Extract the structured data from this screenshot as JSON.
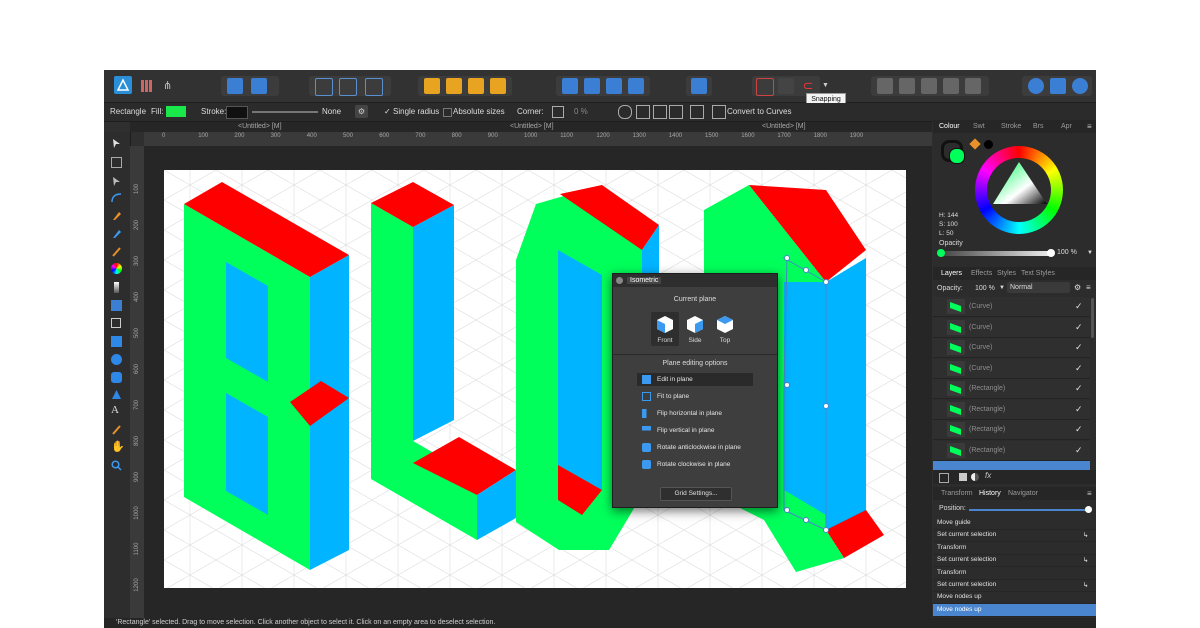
{
  "toolbar": {
    "snapping_tooltip": "Snapping"
  },
  "context": {
    "tool": "Rectangle",
    "fill_label": "Fill:",
    "fill_color": "#1ae84a",
    "stroke_label": "Stroke:",
    "stroke_value": "None",
    "single_radius": "Single radius",
    "absolute_sizes": "Absolute sizes",
    "corner_label": "Corner:",
    "corner_value": "0 %",
    "convert_label": "Convert to Curves"
  },
  "doc_tabs": [
    "<Untitled> [M]",
    "<Untitled> [M]",
    "<Untitled> [M]"
  ],
  "ruler": {
    "h": [
      "0",
      "100",
      "200",
      "300",
      "400",
      "500",
      "600",
      "700",
      "800",
      "900",
      "1000",
      "1100",
      "1200",
      "1300",
      "1400",
      "1500",
      "1600",
      "1700",
      "1800",
      "1900"
    ],
    "v": [
      "100",
      "200",
      "300",
      "400",
      "500",
      "600",
      "700",
      "800",
      "900",
      "1000",
      "1100",
      "1200"
    ]
  },
  "colors": {
    "green": "#00ff5a",
    "red": "#ff0000",
    "blue": "#00b4ff",
    "accent": "#4a86cf"
  },
  "panel": {
    "colour_tabs": [
      "Colour",
      "Swt",
      "Stroke",
      "Brs",
      "Apr"
    ],
    "hsl": {
      "h": "H: 144",
      "s": "S: 100",
      "l": "L: 50"
    },
    "opacity_label": "Opacity",
    "opacity_value": "100 %",
    "layer_tabs": [
      "Layers",
      "Effects",
      "Styles",
      "Text Styles"
    ],
    "layer_opacity_label": "Opacity:",
    "layer_opacity_value": "100 %",
    "blend_mode": "Normal",
    "layers": [
      "(Curve)",
      "(Curve)",
      "(Curve)",
      "(Curve)",
      "(Rectangle)",
      "(Rectangle)",
      "(Rectangle)",
      "(Rectangle)"
    ],
    "history_tabs": [
      "Transform",
      "History",
      "Navigator"
    ],
    "position_label": "Position:",
    "history": [
      "Move guide",
      "Set current selection",
      "Transform",
      "Set current selection",
      "Transform",
      "Set current selection",
      "Move nodes up",
      "Move nodes up"
    ]
  },
  "isometric": {
    "title": "Isometric",
    "current_plane": "Current plane",
    "planes": [
      "Front",
      "Side",
      "Top"
    ],
    "editing_options": "Plane editing options",
    "options": [
      "Edit in plane",
      "Fit to plane",
      "Flip horizontal in plane",
      "Flip vertical in plane",
      "Rotate anticlockwise in plane",
      "Rotate clockwise in plane"
    ],
    "grid_settings": "Grid Settings..."
  },
  "status": "'Rectangle' selected. Drag to move selection. Click another object to select it. Click on an empty area to deselect selection."
}
